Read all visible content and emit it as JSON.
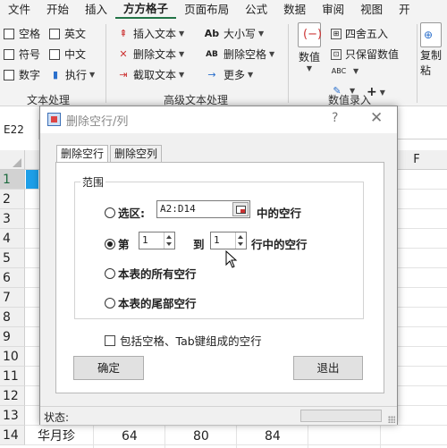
{
  "menu_tabs": [
    "文件",
    "开始",
    "插入",
    "方方格子",
    "页面布局",
    "公式",
    "数据",
    "审阅",
    "视图",
    "开"
  ],
  "active_tab_index": 3,
  "ribbon": {
    "text_processing": {
      "items": [
        "空格",
        "英文",
        "符号",
        "中文",
        "数字",
        "执行"
      ],
      "group_label": "文本处理"
    },
    "advanced_text": {
      "items": [
        "插入文本",
        "删除文本",
        "截取文本",
        "大小写",
        "删除空格",
        "更多"
      ],
      "icons": [
        "Ab",
        "AB"
      ],
      "group_label": "高级文本处理"
    },
    "numeric_entry": {
      "big_button": "数值",
      "items": [
        "四舍五入",
        "只保留数值"
      ],
      "small_icons": [
        "ABC",
        "+"
      ],
      "group_label": "数值录入"
    },
    "copy": {
      "label_line1": "复制",
      "label_line2": "粘"
    }
  },
  "namebox": "E22",
  "sheet": {
    "col_header": "F",
    "rows": [
      {
        "n": "1"
      },
      {
        "n": "2"
      },
      {
        "n": "3"
      },
      {
        "n": "4"
      },
      {
        "n": "5"
      },
      {
        "n": "6"
      },
      {
        "n": "7"
      },
      {
        "n": "8"
      },
      {
        "n": "9"
      },
      {
        "n": "10"
      },
      {
        "n": "11"
      },
      {
        "n": "12"
      },
      {
        "n": "13"
      },
      {
        "n": "14"
      }
    ],
    "row14": {
      "name": "华月珍",
      "v1": "64",
      "v2": "80",
      "v3": "84"
    }
  },
  "dialog": {
    "title": "删除空行/列",
    "help": "?",
    "close": "✕",
    "tabs": [
      "删除空行",
      "删除空列"
    ],
    "legend": "范围",
    "option_selection": "选区:",
    "range_value": "A2:D14",
    "suffix_selection": "中的空行",
    "option_rows_prefix": "第",
    "from_row": "1",
    "to_label": "到",
    "to_row": "1",
    "suffix_rows": "行中的空行",
    "option_all": "本表的所有空行",
    "option_tail": "本表的尾部空行",
    "selected_option": "rows",
    "include_label": "包括空格、Tab键组成的空行",
    "include_checked": false,
    "ok_label": "确定",
    "exit_label": "退出",
    "status_label": "状态:"
  }
}
